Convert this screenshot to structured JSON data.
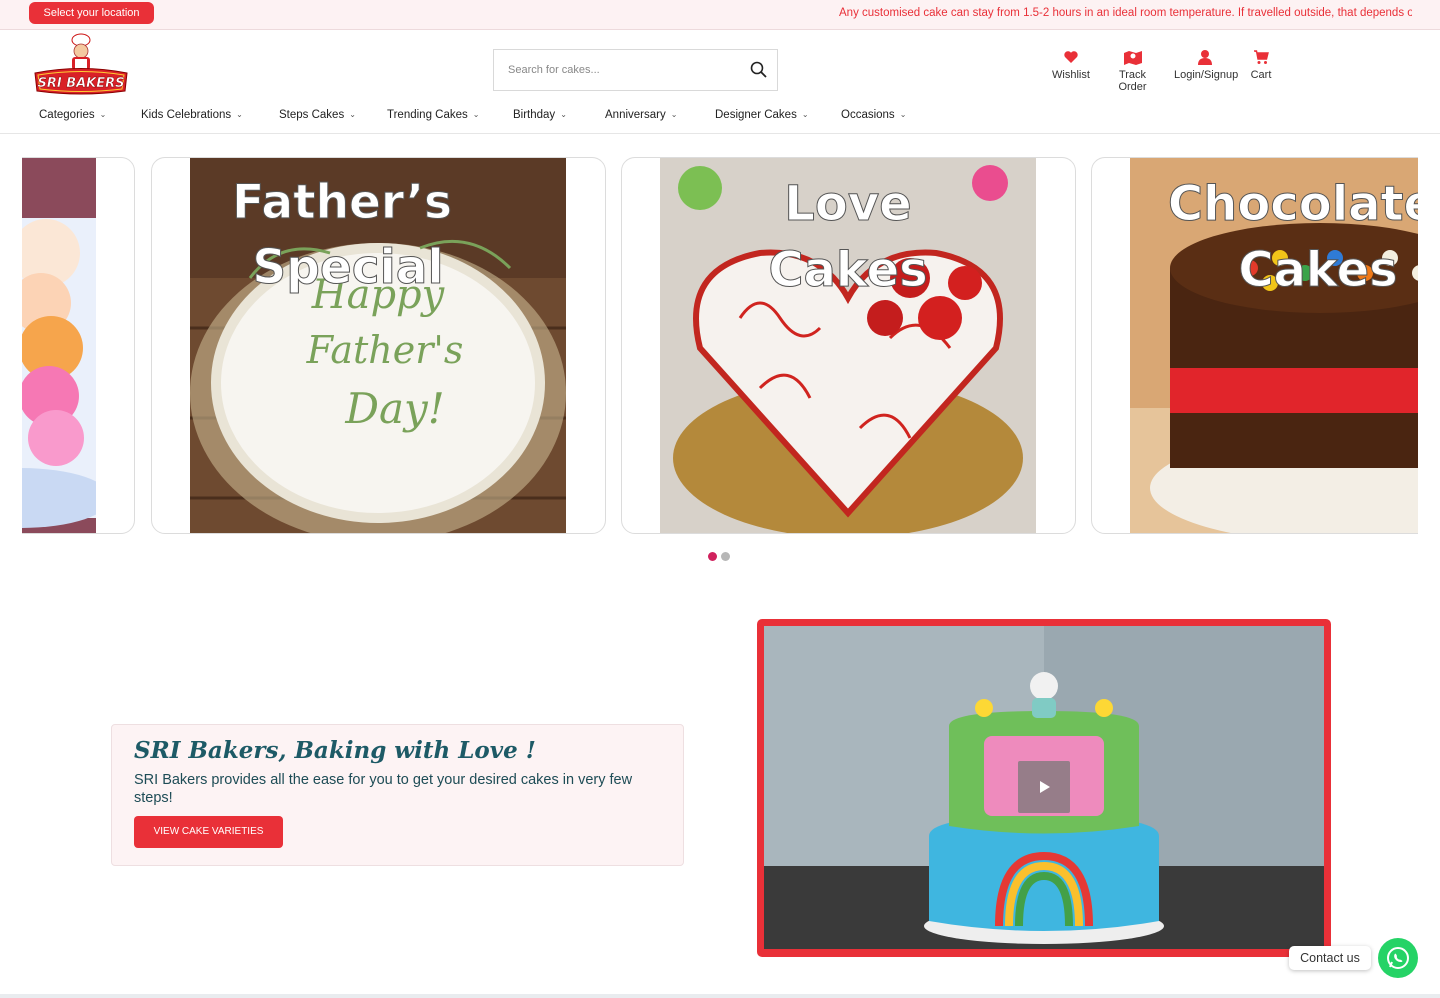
{
  "topbar": {
    "location_button": "Select your location",
    "notice": "Any customised cake can stay from 1.5-2 hours in an ideal room temperature. If travelled outside, that depends on the weather conditions."
  },
  "header": {
    "brand": "SRI BAKERS",
    "search_placeholder": "Search for cakes...",
    "links": {
      "wishlist": "Wishlist",
      "track_order": "Track Order",
      "login": "Login/Signup",
      "cart": "Cart"
    }
  },
  "nav": {
    "items": [
      "Categories",
      "Kids Celebrations",
      "Steps Cakes",
      "Trending Cakes",
      "Birthday",
      "Anniversary",
      "Designer Cakes",
      "Occasions"
    ]
  },
  "carousel": {
    "slides": [
      {
        "line1": "Father’s",
        "line2": "Special",
        "cake_text": [
          "Happy",
          "Father's",
          "Day!"
        ]
      },
      {
        "line1": "Love",
        "line2": "Cakes"
      },
      {
        "line1": "Chocolate",
        "line2": "Cakes"
      }
    ],
    "active_dot": 0,
    "dot_count": 2
  },
  "promo": {
    "title": "SRI Bakers, Baking with Love !",
    "text": "SRI Bakers provides all the ease for you to get your desired cakes in very few steps!",
    "cta": "VIEW CAKE VARIETIES"
  },
  "contact": {
    "label": "Contact us"
  },
  "colors": {
    "brand_red": "#e93038",
    "topbar_bg": "#fdf2f3",
    "teal_text": "#1d5a66",
    "dot_active": "#d0215d",
    "dot_inactive": "#b7b7b7",
    "whatsapp": "#25d366"
  }
}
